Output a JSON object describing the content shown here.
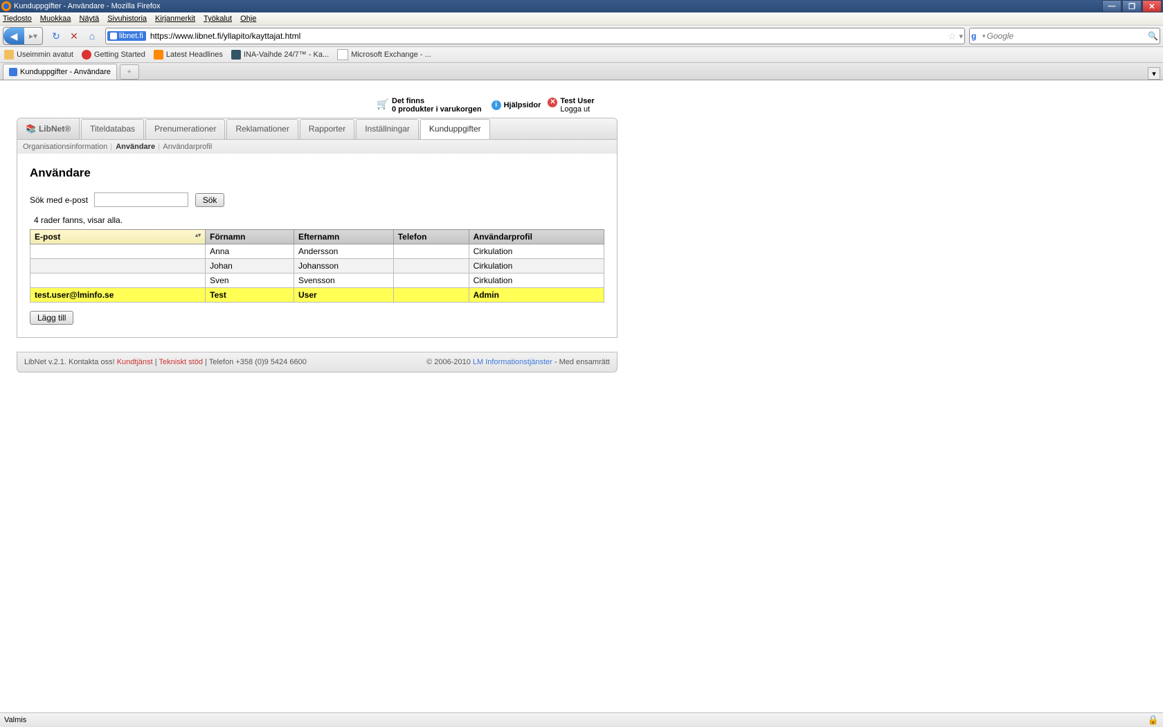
{
  "window": {
    "title": "Kunduppgifter - Användare - Mozilla Firefox"
  },
  "menu": [
    "Tiedosto",
    "Muokkaa",
    "Näytä",
    "Sivuhistoria",
    "Kirjanmerkit",
    "Työkalut",
    "Ohje"
  ],
  "url": {
    "site_label": "libnet.fi",
    "value": "https://www.libnet.fi/yllapito/kayttajat.html"
  },
  "search_placeholder": "Google",
  "bookmarks": [
    "Useimmin avatut",
    "Getting Started",
    "Latest Headlines",
    "INA-Vaihde 24/7™ - Ka...",
    "Microsoft Exchange - ..."
  ],
  "tab_title": "Kunduppgifter - Användare",
  "cart": {
    "line1": "Det finns",
    "line2": "0 produkter i varukorgen"
  },
  "help_label": "Hjälpsidor",
  "user": {
    "name": "Test User",
    "logout": "Logga ut"
  },
  "brand": "LibNet®",
  "maintabs": [
    "Titeldatabas",
    "Prenumerationer",
    "Reklamationer",
    "Rapporter",
    "Inställningar",
    "Kunduppgifter"
  ],
  "subtabs": [
    "Organisationsinformation",
    "Användare",
    "Användarprofil"
  ],
  "page_heading": "Användare",
  "search_label": "Sök med e-post",
  "search_btn": "Sök",
  "result_count": "4 rader fanns, visar alla.",
  "cols": [
    "E-post",
    "Förnamn",
    "Efternamn",
    "Telefon",
    "Användarprofil"
  ],
  "rows": [
    {
      "email": "",
      "fn": "Anna",
      "ln": "Andersson",
      "tel": "",
      "profile": "Cirkulation"
    },
    {
      "email": "",
      "fn": "Johan",
      "ln": "Johansson",
      "tel": "",
      "profile": "Cirkulation"
    },
    {
      "email": "",
      "fn": "Sven",
      "ln": "Svensson",
      "tel": "",
      "profile": "Cirkulation"
    },
    {
      "email": "test.user@lminfo.se",
      "fn": "Test",
      "ln": "User",
      "tel": "",
      "profile": "Admin"
    }
  ],
  "add_btn": "Lägg till",
  "footer": {
    "left_prefix": "LibNet v.2.1. Kontakta oss! ",
    "link1": "Kundtjänst",
    "link2": "Tekniskt stöd",
    "phone": " | Telefon +358 (0)9 5424 6600",
    "right_prefix": "© 2006-2010 ",
    "right_link": "LM Informationstjänster",
    "right_suffix": " - Med ensamrätt"
  },
  "status": "Valmis"
}
